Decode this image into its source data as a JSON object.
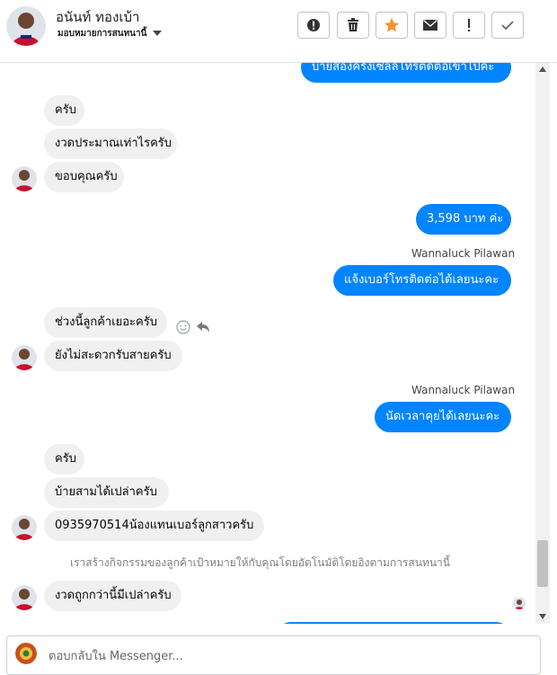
{
  "header": {
    "name": "อนันท์ ทองเบ้า",
    "assign_label": "มอบหมายการสนทนานี้",
    "toolbar": [
      {
        "name": "report-spam-button",
        "icon": "alert-circle-icon"
      },
      {
        "name": "delete-button",
        "icon": "trash-icon"
      },
      {
        "name": "star-button",
        "icon": "star-icon"
      },
      {
        "name": "mark-unread-button",
        "icon": "envelope-icon"
      },
      {
        "name": "follow-up-button",
        "icon": "exclamation-icon"
      },
      {
        "name": "mark-done-button",
        "icon": "check-icon"
      }
    ]
  },
  "messages": {
    "m0": "บ้ายสองครั้งเซลล์โทรติดต่อเข้าไปค่ะ",
    "m1": "ครับ",
    "m2": "งวดประมาณเท่าไรครับ",
    "m3": "ขอบคุณครับ",
    "m4": "3,598 บาท ค่ะ",
    "s1": "Wannaluck Pilawan",
    "m5": "แจ้งเบอร์โทรติดต่อได้เลยนะคะ",
    "m6": "ช่วงนี้ลูกค้าเยอะครับ",
    "m7": "ยังไม่สะดวกรับสายครับ",
    "s2": "Wannaluck Pilawan",
    "m8": "นัดเวลาคุยได้เลยนะคะ",
    "m9": "ครับ",
    "m10": "บ้ายสามได้เปล่าครับ",
    "m11": "0935970514น้องแทนเบอร์ลูกสาวครับ",
    "note": "เราสร้างกิจกรรมของลูกค้าเป้าหมายให้กับคุณโดยอัตโนมัติโดยอิงตามการสนทนานี้",
    "m12": "งวดถูกกว่านี้มีเปล่าครับ"
  },
  "composer": {
    "placeholder": "ตอบกลับใน Messenger..."
  },
  "colors": {
    "outgoing": "#0084ff",
    "incoming": "#f0f0f0",
    "star": "#f5922e"
  }
}
